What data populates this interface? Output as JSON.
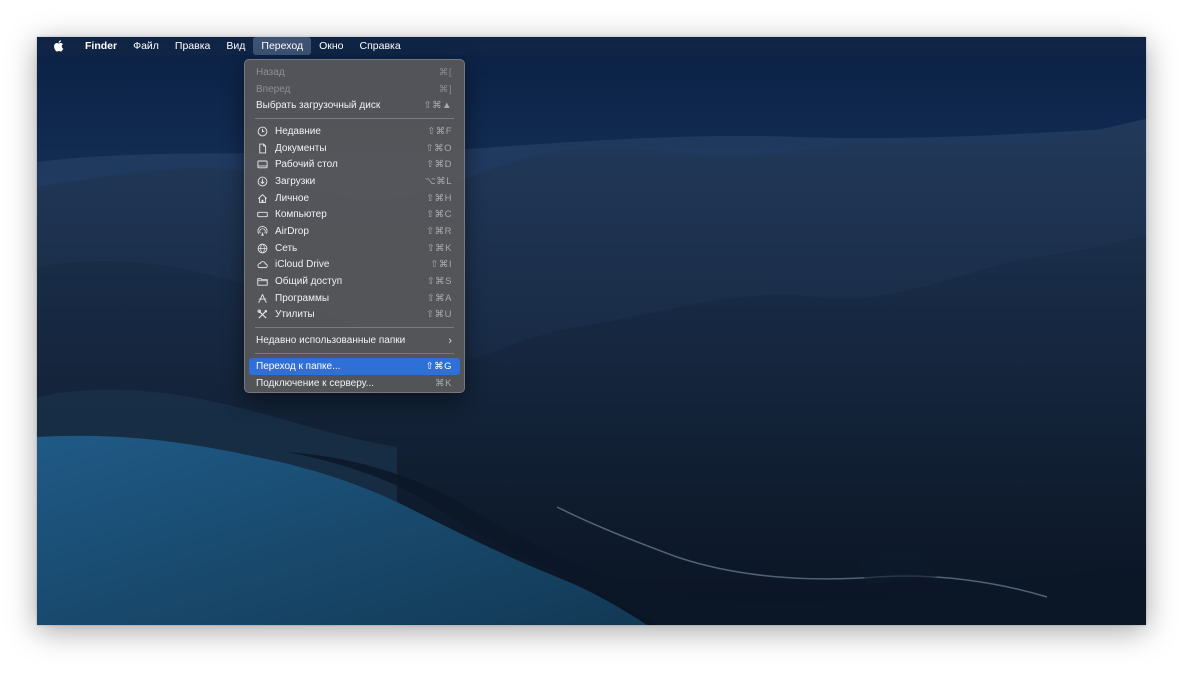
{
  "menubar": {
    "apple_icon": "apple-logo-icon",
    "items": [
      {
        "label": "Finder"
      },
      {
        "label": "Файл"
      },
      {
        "label": "Правка"
      },
      {
        "label": "Вид"
      },
      {
        "label": "Переход"
      },
      {
        "label": "Окно"
      },
      {
        "label": "Справка"
      }
    ]
  },
  "go_menu": {
    "items": [
      {
        "label": "Назад",
        "shortcut": "⌘[",
        "enabled": false
      },
      {
        "label": "Вперед",
        "shortcut": "⌘]",
        "enabled": false
      },
      {
        "label": "Выбрать загрузочный диск",
        "shortcut": "⇧⌘▲",
        "enabled": true
      },
      {
        "label": "Недавние",
        "shortcut": "⇧⌘F",
        "icon": "clock-icon"
      },
      {
        "label": "Документы",
        "shortcut": "⇧⌘O",
        "icon": "document-icon"
      },
      {
        "label": "Рабочий стол",
        "shortcut": "⇧⌘D",
        "icon": "desktop-icon"
      },
      {
        "label": "Загрузки",
        "shortcut": "⌥⌘L",
        "icon": "download-icon"
      },
      {
        "label": "Личное",
        "shortcut": "⇧⌘H",
        "icon": "home-icon"
      },
      {
        "label": "Компьютер",
        "shortcut": "⇧⌘C",
        "icon": "computer-icon"
      },
      {
        "label": "AirDrop",
        "shortcut": "⇧⌘R",
        "icon": "airdrop-icon"
      },
      {
        "label": "Сеть",
        "shortcut": "⇧⌘K",
        "icon": "network-globe-icon"
      },
      {
        "label": "iCloud Drive",
        "shortcut": "⇧⌘I",
        "icon": "cloud-icon"
      },
      {
        "label": "Общий доступ",
        "shortcut": "⇧⌘S",
        "icon": "shared-folder-icon"
      },
      {
        "label": "Программы",
        "shortcut": "⇧⌘A",
        "icon": "applications-icon"
      },
      {
        "label": "Утилиты",
        "shortcut": "⇧⌘U",
        "icon": "utilities-tools-icon"
      },
      {
        "label": "Недавно использованные папки",
        "submenu_icon": "chevron-right-icon"
      },
      {
        "label": "Переход к папке...",
        "shortcut": "⇧⌘G",
        "highlighted": true
      },
      {
        "label": "Подключение к серверу...",
        "shortcut": "⌘K"
      }
    ]
  },
  "colors": {
    "menu_background": "#58585a",
    "highlight": "#2f6fd8",
    "disabled_text": "#8e8e92"
  }
}
